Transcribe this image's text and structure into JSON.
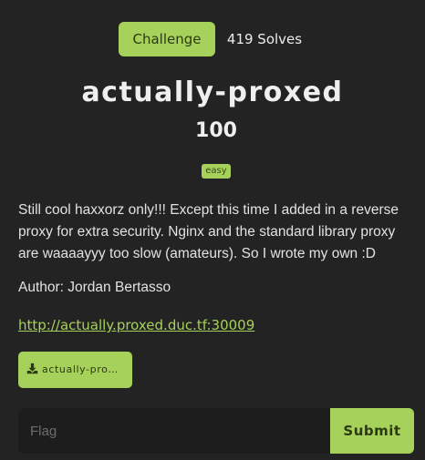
{
  "tabs": {
    "challenge_label": "Challenge",
    "solves_label": "419 Solves"
  },
  "challenge": {
    "name": "actually-proxed",
    "points": "100",
    "difficulty": "easy",
    "description": "Still cool haxxorz only!!! Except this time I added in a reverse proxy for extra security. Nginx and the standard library proxy are waaaayyy too slow (amateurs). So I wrote my own :D",
    "author": "Author: Jordan Bertasso",
    "link": "http://actually.proxed.duc.tf:30009",
    "file_label": "actually-pro…",
    "file_icon": "download-icon"
  },
  "flag_form": {
    "placeholder": "Flag",
    "value": "",
    "submit_label": "Submit"
  },
  "colors": {
    "accent": "#a6d15a",
    "background": "#232323",
    "input_background": "#1d1d1d"
  }
}
